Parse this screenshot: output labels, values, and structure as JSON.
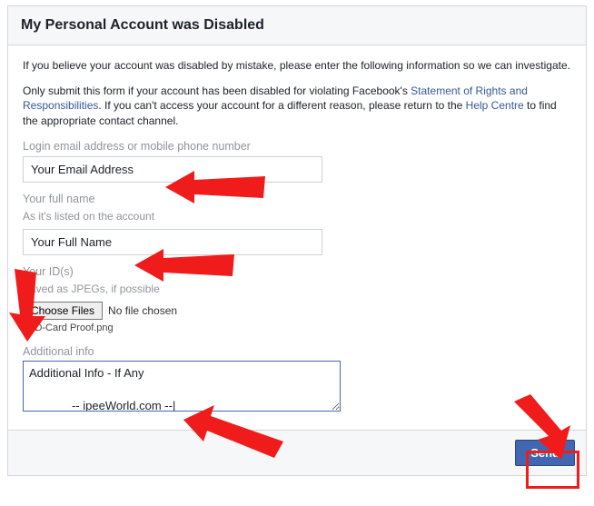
{
  "header": {
    "title": "My Personal Account was Disabled"
  },
  "intro": {
    "p1": "If you believe your account was disabled by mistake, please enter the following information so we can investigate.",
    "p2a": "Only submit this form if your account has been disabled for violating Facebook's ",
    "link1": "Statement of Rights and Responsibilities",
    "p2b": ". If you can't access your account for a different reason, please return to the ",
    "link2": "Help Centre",
    "p2c": " to find the appropriate contact channel."
  },
  "fields": {
    "login": {
      "label": "Login email address or mobile phone number",
      "value": "Your Email Address"
    },
    "name": {
      "label": "Your full name",
      "hint": "As it's listed on the account",
      "value": "Your Full Name"
    },
    "ids": {
      "label": "Your ID(s)",
      "hint": "Saved as JPEGs, if possible",
      "button": "Choose Files",
      "nofile": "No file chosen",
      "uploaded": "ID-Card Proof.png"
    },
    "info": {
      "label": "Additional info",
      "value": "Additional Info - If Any\n\n             -- ipeeWorld.com --|"
    }
  },
  "footer": {
    "send": "Send"
  }
}
